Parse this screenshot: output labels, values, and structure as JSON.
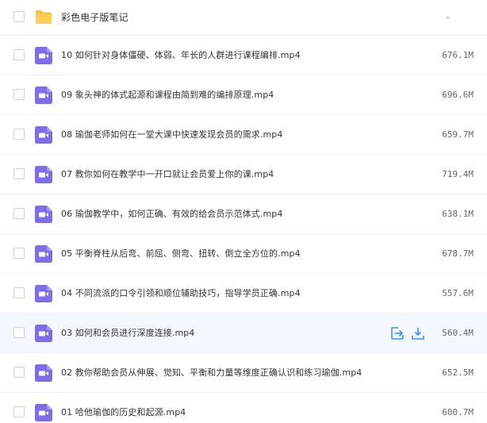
{
  "file_list": {
    "rows": [
      {
        "type": "folder",
        "name": "彩色电子版笔记",
        "size": "-"
      },
      {
        "type": "video",
        "name": "10 如何针对身体僵硬、体弱、年长的人群进行课程编排.mp4",
        "size": "676.1M"
      },
      {
        "type": "video",
        "name": "09 象头神的体式起源和课程由简到难的编排原理.mp4",
        "size": "696.6M"
      },
      {
        "type": "video",
        "name": "08 瑜伽老师如何在一堂大课中快速发现会员的需求.mp4",
        "size": "659.7M"
      },
      {
        "type": "video",
        "name": "07 教你如何在教学中一开口就让会员爱上你的课.mp4",
        "size": "719.4M"
      },
      {
        "type": "video",
        "name": "06 瑜伽教学中，如何正确、有效的给会员示范体式.mp4",
        "size": "638.1M"
      },
      {
        "type": "video",
        "name": "05 平衡脊柱从后弯、前屈、侧弯、扭转、倒立全方位的.mp4",
        "size": "678.7M"
      },
      {
        "type": "video",
        "name": "04 不同流派的口令引领和顺位辅助技巧，指导学员正确.mp4",
        "size": "557.6M"
      },
      {
        "type": "video",
        "name": "03 如何和会员进行深度连接.mp4",
        "size": "560.4M",
        "hovered": true
      },
      {
        "type": "video",
        "name": "02 教你帮助会员从伸展、觉知、平衡和力量等维度正确认识和练习瑜伽.mp4",
        "size": "652.5M"
      },
      {
        "type": "video",
        "name": "01 哈他瑜伽的历史和起源.mp4",
        "size": "600.7M"
      }
    ],
    "row_actions": [
      {
        "icon": "share-icon"
      },
      {
        "icon": "download-icon"
      }
    ]
  },
  "colors": {
    "folder": "#f8c23c",
    "video_icon": "#7e6de8",
    "action_icon": "#3b8ff0",
    "hover_bg": "#f3f8fe"
  }
}
